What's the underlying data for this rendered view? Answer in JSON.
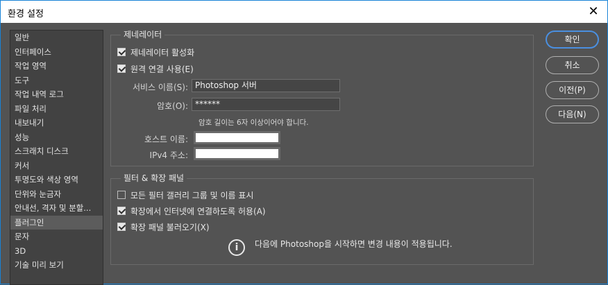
{
  "window": {
    "title": "환경 설정",
    "close_label": "✕"
  },
  "sidebar": {
    "items": [
      "일반",
      "인터페이스",
      "작업 영역",
      "도구",
      "작업 내역 로그",
      "파일 처리",
      "내보내기",
      "성능",
      "스크래치 디스크",
      "커서",
      "투명도와 색상 영역",
      "단위와 눈금자",
      "안내선, 격자 및 분할...",
      "플러그인",
      "문자",
      "3D",
      "기술 미리 보기"
    ],
    "selected_index": 13
  },
  "generator": {
    "title": "제네레이터",
    "enable_label": "제네레이터 활성화",
    "enable_checked": true,
    "remote_label": "원격 연결 사용(E)",
    "remote_checked": true,
    "service_name_label": "서비스 이름(S):",
    "service_name_value": "Photoshop 서버",
    "password_label": "암호(O):",
    "password_value": "******",
    "password_hint": "암호 길이는 6자 이상이어야 합니다.",
    "host_label": "호스트 이름:",
    "ipv4_label": "IPv4 주소:"
  },
  "filters": {
    "title": "필터 & 확장 패널",
    "show_all_label": "모든 필터 갤러리 그룹 및 이름 표시",
    "show_all_checked": false,
    "allow_internet_label": "확장에서 인터넷에 연결하도록 허용(A)",
    "allow_internet_checked": true,
    "load_panels_label": "확장 패널 불러오기(X)",
    "load_panels_checked": true,
    "info_text": "다음에 Photoshop을 시작하면 변경 내용이 적용됩니다."
  },
  "buttons": {
    "ok": "확인",
    "cancel": "취소",
    "prev": "이전(P)",
    "next": "다음(N)"
  }
}
